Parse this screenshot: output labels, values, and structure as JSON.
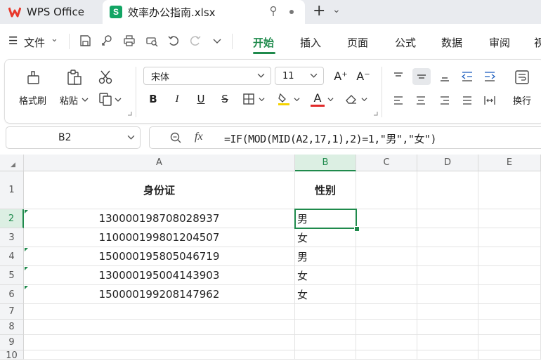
{
  "tabs": {
    "app_label": "WPS Office",
    "file_label": "效率办公指南.xlsx",
    "file_icon_letter": "S",
    "new_tab_symbol": "+",
    "tabs_menu_symbol": "⌄"
  },
  "menu": {
    "hamburger": "☰",
    "file_label": "文件",
    "file_chevron": "⌄",
    "items": [
      "开始",
      "插入",
      "页面",
      "公式",
      "数据",
      "审阅",
      "视"
    ],
    "active": "开始"
  },
  "ribbon": {
    "format_painter": "格式刷",
    "paste": "粘贴",
    "font_name": "宋体",
    "font_size": "11",
    "wrap_text": "换行",
    "bold": "B",
    "italic": "I",
    "underline": "U",
    "strike": "S",
    "font_color_letter": "A",
    "grow_font": "A⁺",
    "shrink_font": "A⁻"
  },
  "formula_bar": {
    "name_box": "B2",
    "fx": "fx",
    "formula": "=IF(MOD(MID(A2,17,1),2)=1,\"男\",\"女\")"
  },
  "sheet": {
    "columns": [
      "A",
      "B",
      "C",
      "D",
      "E"
    ],
    "corner": "◢",
    "rows": [
      {
        "n": "1",
        "a": "身份证",
        "b": "性别"
      },
      {
        "n": "2",
        "a": "130000198708028937",
        "b": "男"
      },
      {
        "n": "3",
        "a": "110000199801204507",
        "b": "女"
      },
      {
        "n": "4",
        "a": "150000195805046719",
        "b": "男"
      },
      {
        "n": "5",
        "a": "130000195004143903",
        "b": "女"
      },
      {
        "n": "6",
        "a": "150000199208147962",
        "b": "女"
      },
      {
        "n": "7",
        "a": "",
        "b": ""
      },
      {
        "n": "8",
        "a": "",
        "b": ""
      },
      {
        "n": "9",
        "a": "",
        "b": ""
      },
      {
        "n": "10",
        "a": "",
        "b": ""
      }
    ],
    "selected_cell": "B2"
  },
  "colors": {
    "accent_green": "#1f8a4c",
    "wps_red": "#e8382b",
    "highlight_yellow": "#f5d300",
    "font_red": "#e12a2a"
  }
}
